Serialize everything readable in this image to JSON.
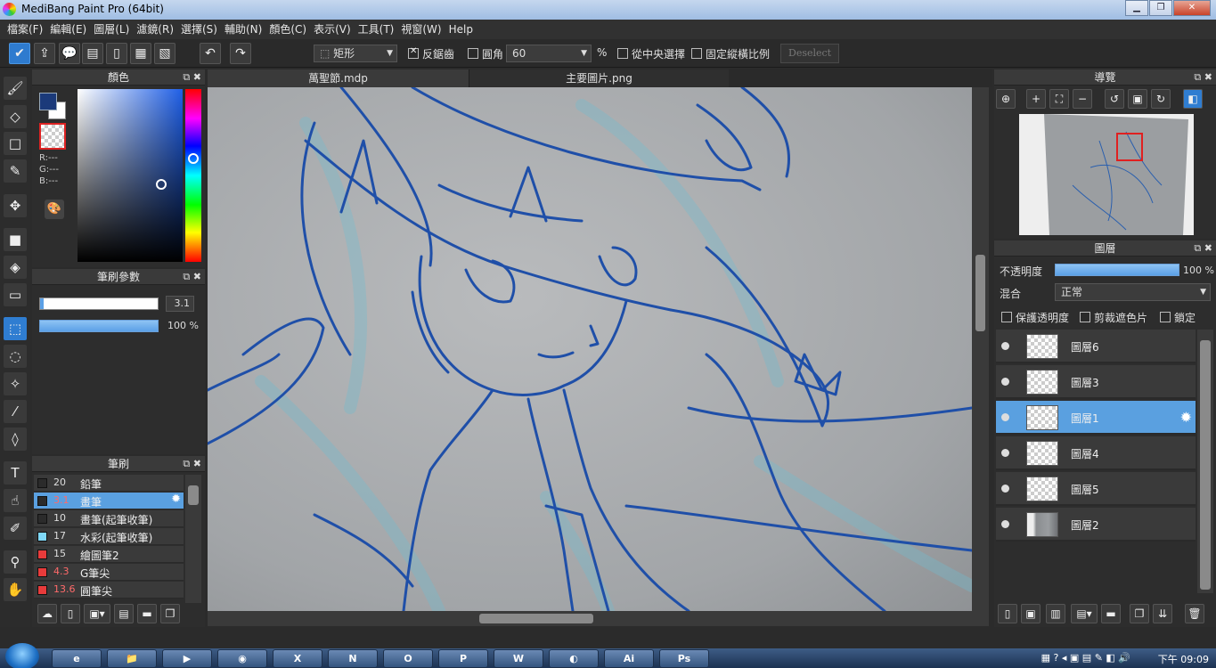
{
  "window": {
    "title": "MediBang Paint Pro (64bit)",
    "minimize": "▁",
    "maximize": "❐",
    "close": "✕"
  },
  "menu": [
    "檔案(F)",
    "編輯(E)",
    "圖層(L)",
    "濾鏡(R)",
    "選擇(S)",
    "輔助(N)",
    "顏色(C)",
    "表示(V)",
    "工具(T)",
    "視窗(W)",
    "Help"
  ],
  "toolbar": {
    "selection_shape": "矩形",
    "antialias_label": "反鋸齒",
    "round_corner_label": "圓角",
    "round_corner_value": "60",
    "percent": "%",
    "from_center_label": "從中央選擇",
    "fixed_ratio_label": "固定縱橫比例",
    "deselect_label": "Deselect"
  },
  "color_panel": {
    "title": "顏色",
    "r": "R:---",
    "g": "G:---",
    "b": "B:---",
    "fg_color": "#1b3a7a",
    "bg_color": "#ffffff",
    "sv_cursor": {
      "saturation": 0.8,
      "value": 0.45
    },
    "hue_cursor_fraction": 0.4
  },
  "brush_param": {
    "title": "筆刷參數",
    "size": "3.1",
    "size_fraction": 0.03,
    "opacity_label": "100 %",
    "opacity_fraction": 1.0
  },
  "brush_panel": {
    "title": "筆刷",
    "items": [
      {
        "size": "20",
        "name": "鉛筆",
        "color": "#2b2b2b",
        "size_red": false,
        "selected": false
      },
      {
        "size": "3.1",
        "name": "畫筆",
        "color": "#2b2b2b",
        "size_red": true,
        "selected": true
      },
      {
        "size": "10",
        "name": "畫筆(起筆收筆)",
        "color": "#2b2b2b",
        "size_red": false,
        "selected": false
      },
      {
        "size": "17",
        "name": "水彩(起筆收筆)",
        "color": "#7fd8f8",
        "size_red": false,
        "selected": false
      },
      {
        "size": "15",
        "name": "繪圖筆2",
        "color": "#e83b3b",
        "size_red": false,
        "selected": false
      },
      {
        "size": "4.3",
        "name": "G筆尖",
        "color": "#e83b3b",
        "size_red": true,
        "selected": false
      },
      {
        "size": "13.6",
        "name": "圓筆尖",
        "color": "#e83b3b",
        "size_red": true,
        "selected": false
      }
    ]
  },
  "tabs": [
    {
      "label": "萬聖節.mdp",
      "active": true
    },
    {
      "label": "主要圖片.png",
      "active": false
    }
  ],
  "navigator": {
    "title": "導覽"
  },
  "layer_panel": {
    "title": "圖層",
    "opacity_label": "不透明度",
    "opacity_value": "100 %",
    "opacity_fraction": 1.0,
    "blend_label": "混合",
    "blend_value": "正常",
    "protect_alpha_label": "保護透明度",
    "clipping_label": "剪裁遮色片",
    "lock_label": "鎖定",
    "layers": [
      {
        "name": "圖層6",
        "selected": false,
        "photo": false
      },
      {
        "name": "圖層3",
        "selected": false,
        "photo": false
      },
      {
        "name": "圖層1",
        "selected": true,
        "photo": false
      },
      {
        "name": "圖層4",
        "selected": false,
        "photo": false
      },
      {
        "name": "圖層5",
        "selected": false,
        "photo": false
      },
      {
        "name": "圖層2",
        "selected": false,
        "photo": true
      }
    ]
  },
  "taskbar": {
    "apps": [
      "e",
      "📁",
      "▶",
      "◉",
      "X",
      "N",
      "O",
      "P",
      "W",
      "◐",
      "Ai",
      "Ps"
    ],
    "time": "下午 09:09"
  }
}
